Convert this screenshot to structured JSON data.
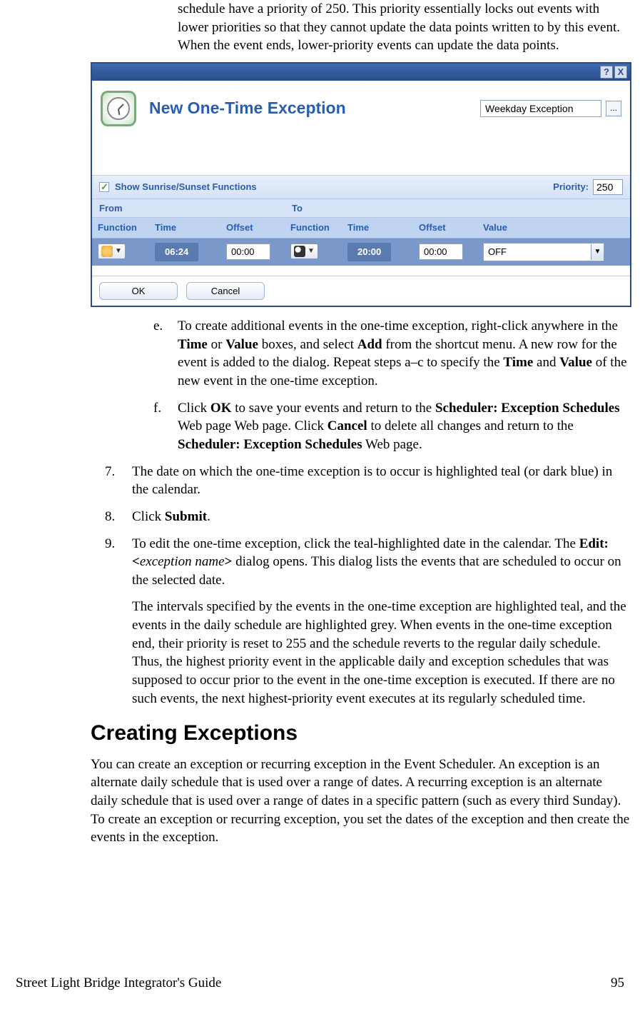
{
  "intro": "schedule have a priority of 250.  This priority essentially locks out events with lower priorities so that they cannot update the data points written to by this event.  When the event ends, lower-priority events can update the data points.",
  "dialog": {
    "title": "New One-Time Exception",
    "name_value": "Weekday Exception",
    "ellipsis": "...",
    "show_sun": "Show Sunrise/Sunset Functions",
    "priority_label": "Priority:",
    "priority_value": "250",
    "group_from": "From",
    "group_to": "To",
    "col_function": "Function",
    "col_time": "Time",
    "col_offset": "Offset",
    "col_value": "Value",
    "row": {
      "from_time": "06:24",
      "from_offset": "00:00",
      "to_time": "20:00",
      "to_offset": "00:00",
      "value": "OFF"
    },
    "ok": "OK",
    "cancel": "Cancel",
    "help": "?",
    "close": "X"
  },
  "step_e": {
    "marker": "e.",
    "t1": "To create additional events in the one-time exception, right-click anywhere in the ",
    "b1": "Time",
    "t2": " or ",
    "b2": "Value",
    "t3": " boxes, and select ",
    "b3": "Add",
    "t4": " from the shortcut menu.  A new row for the event is added to the dialog. Repeat steps a–c to specify the ",
    "b4": "Time",
    "t5": " and ",
    "b5": "Value",
    "t6": " of the new event in the one-time exception."
  },
  "step_f": {
    "marker": "f.",
    "t1": "Click ",
    "b1": "OK",
    "t2": " to save your events and return to the ",
    "b2": "Scheduler: Exception Schedules",
    "t3": " Web page Web page.  Click ",
    "b3": "Cancel",
    "t4": " to delete all changes and return to the ",
    "b4": "Scheduler: Exception Schedules",
    "t5": " Web page."
  },
  "step_7": {
    "marker": "7.",
    "text": "The date on which the one-time exception is to occur is highlighted teal (or dark blue) in the calendar."
  },
  "step_8": {
    "marker": "8.",
    "t1": "Click ",
    "b1": "Submit",
    "t2": "."
  },
  "step_9": {
    "marker": "9.",
    "t1": "To edit the one-time exception, click the teal-highlighted date in the calendar.  The ",
    "b1": "Edit: <",
    "i1": "exception name",
    "b2": ">",
    "t2": " dialog opens.  This dialog lists the events that are scheduled to occur on the selected date."
  },
  "step_9b": "The intervals specified by the events in the one-time exception are highlighted teal, and the events in the daily schedule are highlighted grey.  When events in the one-time exception end, their priority is reset to 255 and the schedule reverts to the regular daily schedule.  Thus, the highest priority event in the applicable daily and exception schedules that was supposed to occur prior to the event in the one-time exception is executed.  If there are no such events, the next highest-priority event executes at its regularly scheduled time.",
  "heading": "Creating Exceptions",
  "creating_text": "You can create an exception or recurring exception in the Event Scheduler.  An exception is an alternate daily schedule that is used over a range of dates.  A recurring exception is an alternate daily schedule that is used over a range of dates in a specific pattern (such as every third Sunday).  To create an exception or recurring exception, you set the dates of the exception and then create the events in the exception.",
  "footer_left": "Street Light Bridge Integrator's Guide",
  "footer_right": "95"
}
